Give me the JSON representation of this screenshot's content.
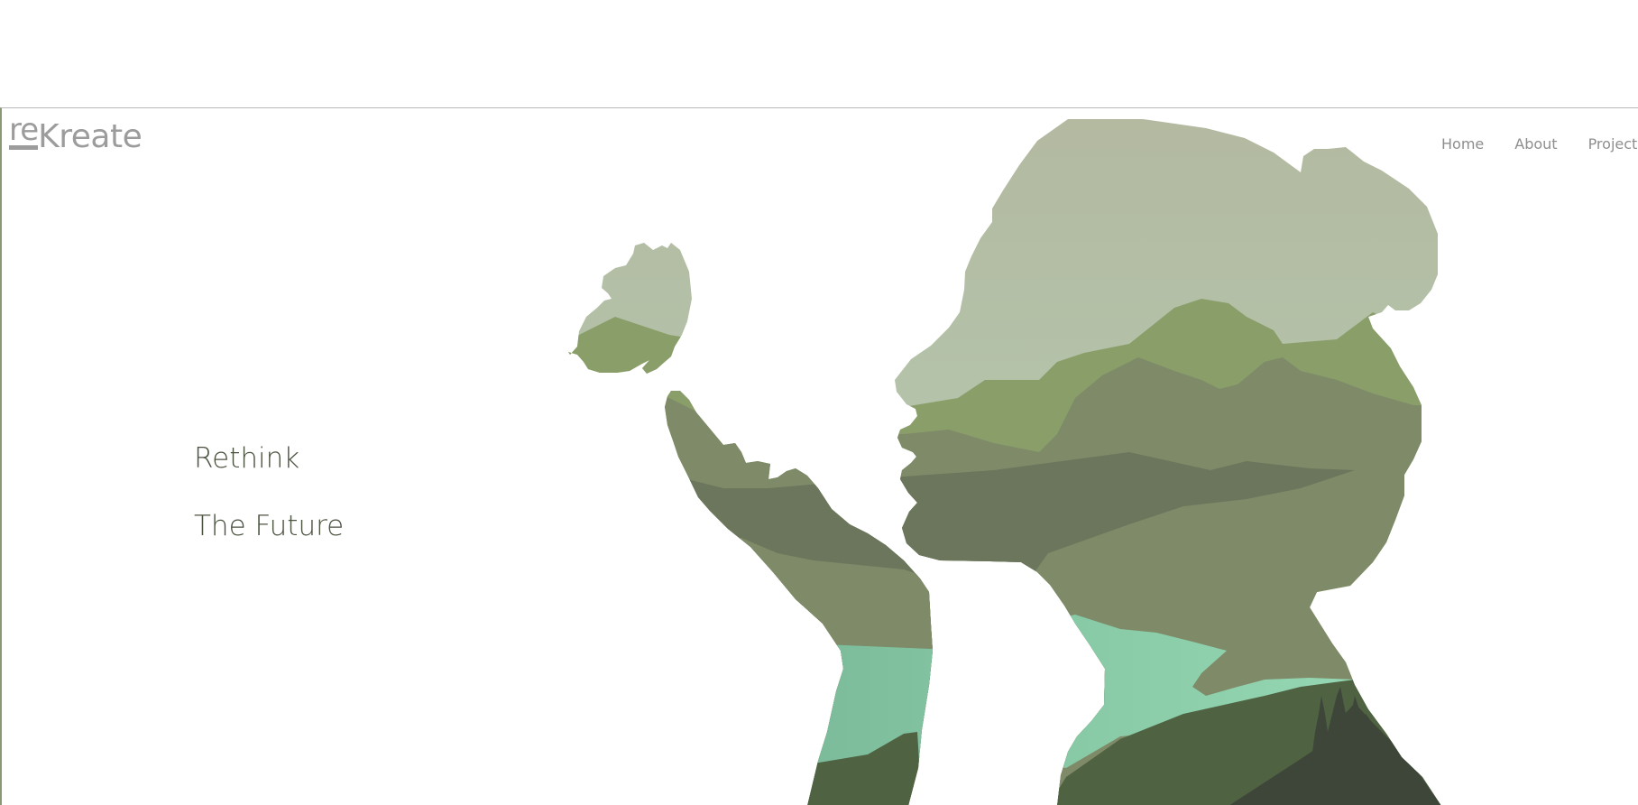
{
  "header": {
    "logo": {
      "prefix": "re",
      "suffix": "Kreate"
    },
    "nav": [
      {
        "label": "Home"
      },
      {
        "label": "About"
      },
      {
        "label": "Projects"
      }
    ]
  },
  "hero": {
    "line1": "Rethink",
    "line2": "The Future"
  },
  "colors": {
    "hero_text": "#4a5240",
    "nav_text": "#8e8e8e",
    "logo": "#9c9c9c",
    "sky": "#b6c4a8",
    "hill_light": "#8a9e6a",
    "hill_mid": "#7e8a68",
    "hill_dark": "#6b765c",
    "lake": "#96d6b2",
    "forest": "#4f6242",
    "forest_dark": "#3e4639"
  }
}
